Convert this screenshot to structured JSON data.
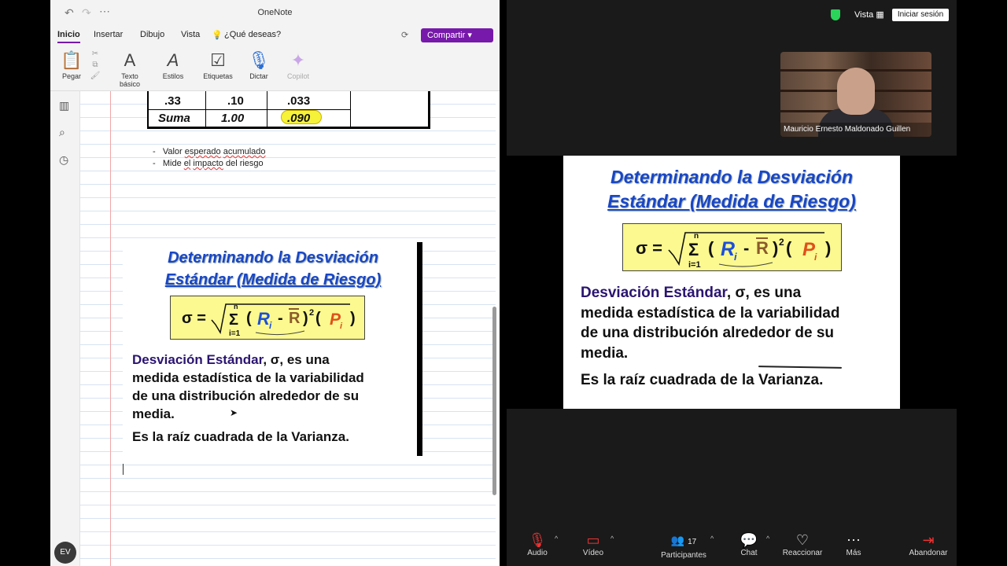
{
  "onenote": {
    "title": "OneNote",
    "menu": [
      "Inicio",
      "Insertar",
      "Dibujo",
      "Vista"
    ],
    "search_label": "¿Qué deseas?",
    "share_label": "Compartir",
    "ribbon": {
      "paste": "Pegar",
      "text_line1": "Texto",
      "text_line2": "básico",
      "styles": "Estilos",
      "tags": "Etiquetas",
      "dictate": "Dictar",
      "copilot": "Copilot"
    },
    "user_initials": "EV",
    "table": {
      "row1": [
        ".33",
        ".10",
        ".033"
      ],
      "row2": [
        "Suma",
        "1.00",
        ".090"
      ]
    },
    "bullets": [
      {
        "a": "Valor ",
        "u": "esperado",
        "b": " ",
        "u2": "acumulado",
        "c": ""
      },
      {
        "a": "Mide ",
        "u": "el",
        "b": " ",
        "u2": "impacto",
        "c": " del riesgo"
      }
    ]
  },
  "slide": {
    "title_line1": "Determinando la Desviación",
    "title_line2": "Estándar (Medida de Riesgo)",
    "formula_sigma": "σ =",
    "formula_sum_top": "n",
    "formula_sum_bottom": "i=1",
    "formula_sum": "Σ",
    "term": "Desviación Estándar",
    "sigma_sym": "σ",
    "definition_rest": ", es una medida estadística de la variabilidad de una distribución alrededor de su media.",
    "definition_line1_rest": ", es una",
    "definition_line2": "medida estadística de la variabilidad",
    "definition_line3": "de una distribución alrededor de su",
    "definition_line4": "media.",
    "root_text": "Es la raíz cuadrada de la Varianza."
  },
  "zoom": {
    "view_label": "Vista",
    "signin_label": "Iniciar sesión",
    "participant_name": "Mauricio Ernesto Maldonado Guillen",
    "toolbar": {
      "audio": "Audio",
      "video": "Vídeo",
      "participants": "Participantes",
      "participants_count": "17",
      "chat": "Chat",
      "react": "Reaccionar",
      "more": "Más",
      "leave": "Abandonar"
    }
  }
}
